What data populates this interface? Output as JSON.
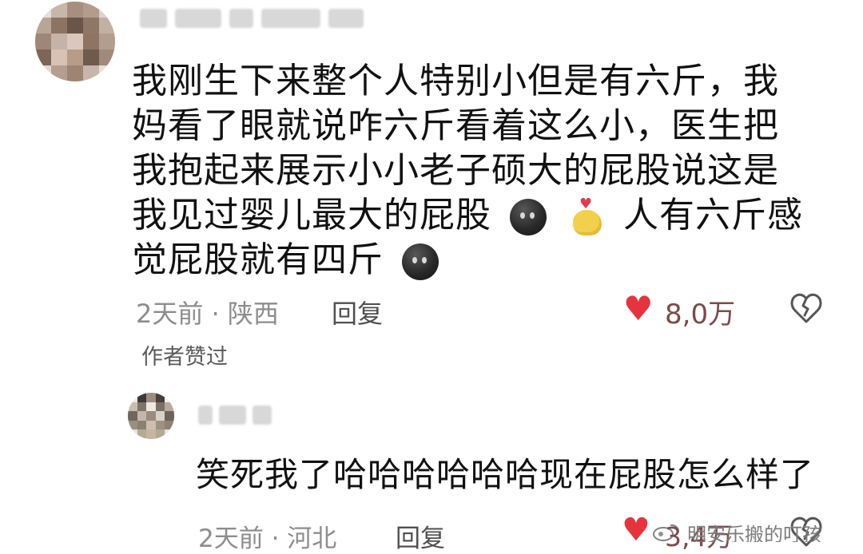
{
  "comment": {
    "text": "我刚生下来整个人特别小但是有六斤，我妈看了眼就说咋六斤看着这么小，医生把我抱起来展示小小老子硕大的屁股说这是我见过婴儿最大的屁股",
    "text_tail": "人有六斤感觉屁股就有四斤",
    "time_location": "2天前 · 陕西",
    "reply_label": "回复",
    "likes": "8,0万",
    "author_liked": "作者赞过"
  },
  "reply": {
    "text": "笑死我了哈哈哈哈哈哈现在屁股怎么样了",
    "time_location": "2天前 · 河北",
    "reply_label": "回复",
    "likes": "3,4万"
  },
  "watermark": {
    "text": "明安乐搬的叮孩"
  },
  "icons": {
    "like": "heart-icon",
    "dislike": "broken-heart-icon",
    "emoji_dark": "dark-face-emoji-icon",
    "emoji_hand": "finger-heart-emoji-icon"
  },
  "colors": {
    "like_red": "#e6343f",
    "meta_gray": "#8d8d8d",
    "text_black": "#111111"
  }
}
